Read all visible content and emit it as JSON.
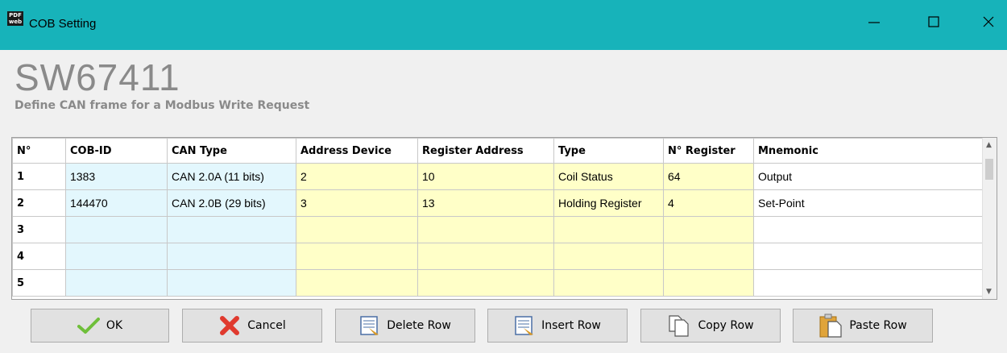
{
  "window": {
    "title": "COB Setting",
    "icon_text_top": "PDF",
    "icon_text_bottom": "web"
  },
  "header": {
    "product": "SW67411",
    "subtitle": "Define CAN frame for a Modbus Write Request"
  },
  "table": {
    "columns": [
      "N°",
      "COB-ID",
      "CAN Type",
      "Address Device",
      "Register Address",
      "Type",
      "N° Register",
      "Mnemonic"
    ],
    "rows": [
      {
        "n": "1",
        "cob_id": "1383",
        "can_type": "CAN 2.0A (11 bits)",
        "address_device": "2",
        "register_address": "10",
        "type": "Coil Status",
        "n_register": "64",
        "mnemonic": "Output"
      },
      {
        "n": "2",
        "cob_id": "144470",
        "can_type": "CAN 2.0B (29 bits)",
        "address_device": "3",
        "register_address": "13",
        "type": "Holding Register",
        "n_register": "4",
        "mnemonic": "Set-Point"
      },
      {
        "n": "3",
        "cob_id": "",
        "can_type": "",
        "address_device": "",
        "register_address": "",
        "type": "",
        "n_register": "",
        "mnemonic": ""
      },
      {
        "n": "4",
        "cob_id": "",
        "can_type": "",
        "address_device": "",
        "register_address": "",
        "type": "",
        "n_register": "",
        "mnemonic": ""
      },
      {
        "n": "5",
        "cob_id": "",
        "can_type": "",
        "address_device": "",
        "register_address": "",
        "type": "",
        "n_register": "",
        "mnemonic": ""
      }
    ]
  },
  "buttons": {
    "ok": "OK",
    "cancel": "Cancel",
    "delete_row": "Delete Row",
    "insert_row": "Insert Row",
    "copy_row": "Copy Row",
    "paste_row": "Paste Row"
  },
  "colors": {
    "titlebar": "#17b3ba",
    "editable_blue": "#e3f7fd",
    "editable_yellow": "#ffffc8"
  },
  "icons": [
    "checkmark-icon",
    "cancel-x-icon",
    "delete-row-icon",
    "insert-row-icon",
    "copy-icon",
    "paste-icon"
  ]
}
